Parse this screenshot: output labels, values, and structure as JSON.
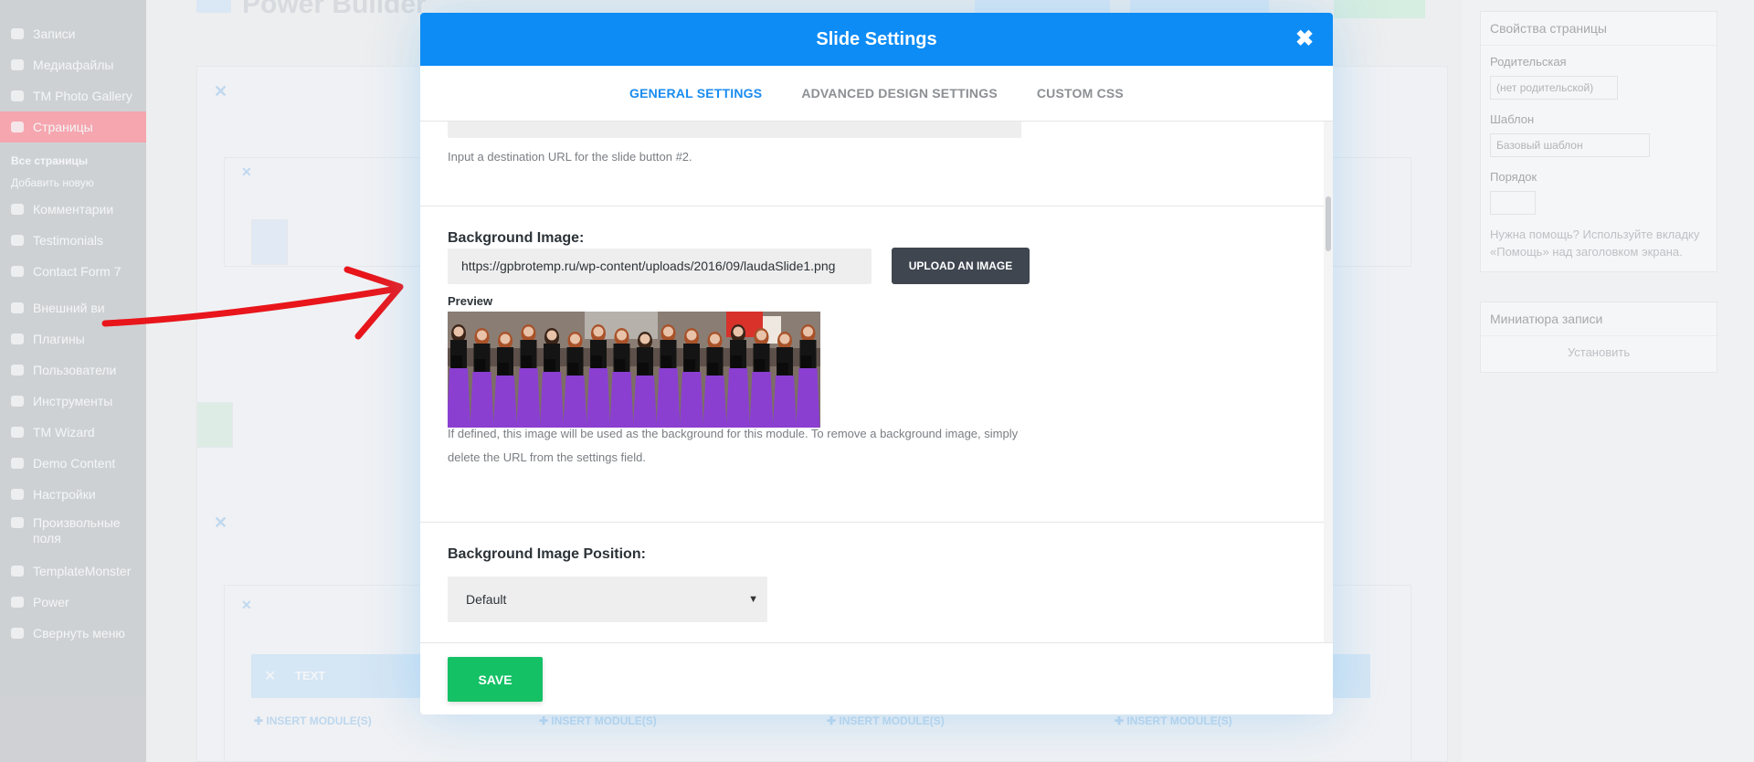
{
  "sidebar": {
    "items": [
      {
        "label": "Записи"
      },
      {
        "label": "Медиафайлы"
      },
      {
        "label": "TM Photo Gallery"
      },
      {
        "label": "Страницы"
      },
      {
        "label": "Все страницы"
      },
      {
        "label": "Добавить новую"
      },
      {
        "label": "Комментарии"
      },
      {
        "label": "Testimonials"
      },
      {
        "label": "Contact Form 7"
      },
      {
        "label": "Внешний ви"
      },
      {
        "label": "Плагины"
      },
      {
        "label": "Пользователи"
      },
      {
        "label": "Инструменты"
      },
      {
        "label": "TM Wizard"
      },
      {
        "label": "Demo Content"
      },
      {
        "label": "Настройки"
      },
      {
        "label": "Произвольные поля"
      },
      {
        "label": "TemplateMonster"
      },
      {
        "label": "Power"
      },
      {
        "label": "Свернуть меню"
      }
    ]
  },
  "background": {
    "builder_title": "Power Builder",
    "row_label": "TEXT",
    "insert_label": "INSERT MODULE(S)"
  },
  "right_panel": {
    "box_title": "Свойства страницы",
    "parent_label": "Родительская",
    "parent_value": "(нет родительской)",
    "template_label": "Шаблон",
    "template_value": "Базовый шаблон",
    "order_label": "Порядок",
    "help_text": "Нужна помощь? Используйте вкладку «Помощь» над заголовком экрана.",
    "box2_title": "Миниатюра записи",
    "box2_link": "Установить"
  },
  "modal": {
    "title": "Slide Settings",
    "close_icon": "close-icon",
    "tabs": [
      {
        "label": "GENERAL SETTINGS",
        "active": true
      },
      {
        "label": "ADVANCED DESIGN SETTINGS",
        "active": false
      },
      {
        "label": "CUSTOM CSS",
        "active": false
      }
    ],
    "button2_url_description": "Input a destination URL for the slide button #2.",
    "background_image": {
      "label": "Background Image:",
      "value": "https://gpbrotemp.ru/wp-content/uploads/2016/09/laudaSlide1.png",
      "upload_button": "UPLOAD AN IMAGE",
      "preview_label": "Preview",
      "description_line1": "If defined, this image will be used as the background for this module. To remove a background image, simply",
      "description_line2": "delete the URL from the settings field."
    },
    "background_position": {
      "label": "Background Image Position:",
      "value": "Default"
    },
    "save_label": "SAVE"
  },
  "colors": {
    "header": "#0d8cf5",
    "active_tab": "#1a8cf0",
    "save": "#14c165",
    "upload": "#3f4650",
    "arrow": "#e8151b"
  }
}
